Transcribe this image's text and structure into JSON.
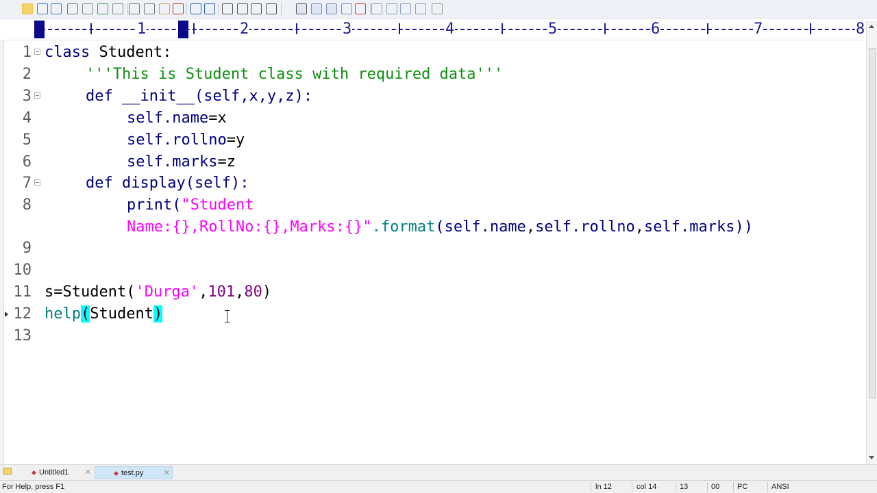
{
  "toolbar": {
    "icons": [
      "new-file-icon",
      "open-folder-icon",
      "save-icon",
      "save-all-icon",
      "print-icon",
      "print-preview-icon",
      "spell-check-icon",
      "properties-icon",
      "cut-icon",
      "copy-icon",
      "paste-icon",
      "delete-icon",
      "undo-icon",
      "redo-icon",
      "find-icon",
      "replace-icon",
      "find-in-files-icon",
      "goto-icon",
      "hex-icon",
      "word-wrap-icon",
      "list-icon",
      "spell-icon",
      "check-icon",
      "window-icon",
      "window-toggle-icon",
      "tile-icon",
      "cascade-icon",
      "help-icon"
    ]
  },
  "ruler": {
    "numbers": [
      "1",
      "2",
      "3",
      "4",
      "5",
      "6",
      "7",
      "8"
    ]
  },
  "editor": {
    "lines": [
      {
        "n": "1"
      },
      {
        "n": "2"
      },
      {
        "n": "3"
      },
      {
        "n": "4"
      },
      {
        "n": "5"
      },
      {
        "n": "6"
      },
      {
        "n": "7"
      },
      {
        "n": "8"
      },
      {
        "n": ""
      },
      {
        "n": "9"
      },
      {
        "n": "10"
      },
      {
        "n": "11"
      },
      {
        "n": "12"
      },
      {
        "n": "13"
      }
    ],
    "code": {
      "l1_kw": "class",
      "l1_rest": " Student:",
      "l2_doc": "'''This is Student class with required data'''",
      "l3_kw": "def",
      "l3_name": " __init__",
      "l3_rest": "(self,x,y,z):",
      "l4_self": "self",
      "l4_attr": ".name",
      "l4_rest": "=x",
      "l5_self": "self",
      "l5_attr": ".rollno",
      "l5_rest": "=y",
      "l6_self": "self",
      "l6_attr": ".marks",
      "l6_rest": "=z",
      "l7_kw": "def",
      "l7_name": " display",
      "l7_rest": "(self):",
      "l8_print": "print",
      "l8_paren": "(",
      "l8_str": "\"Student",
      "l8b_str": "Name:{},RollNo:{},Marks:{}\"",
      "l8b_fmt": ".format",
      "l8b_p1": "(",
      "l8b_s1": "self",
      "l8b_a1": ".name",
      "l8b_c1": ",",
      "l8b_s2": "self",
      "l8b_a2": ".rollno",
      "l8b_c2": ",",
      "l8b_s3": "self",
      "l8b_a3": ".marks",
      "l8b_end": "))",
      "l11_a": "s=Student(",
      "l11_str": "'Durga'",
      "l11_c": ",",
      "l11_n1": "101",
      "l11_c2": ",",
      "l11_n2": "80",
      "l11_end": ")",
      "l12_fn": "help",
      "l12_p1": "(",
      "l12_arg": "Student",
      "l12_p2": ")"
    }
  },
  "tabs": [
    {
      "label": "Untitled1",
      "close": "✕"
    },
    {
      "label": "test.py",
      "close": "✕"
    }
  ],
  "status": {
    "help": "For Help, press F1",
    "line": "ln 12",
    "col": "col 14",
    "chars": "13",
    "code": "00",
    "eol": "PC",
    "encoding": "ANSI"
  }
}
